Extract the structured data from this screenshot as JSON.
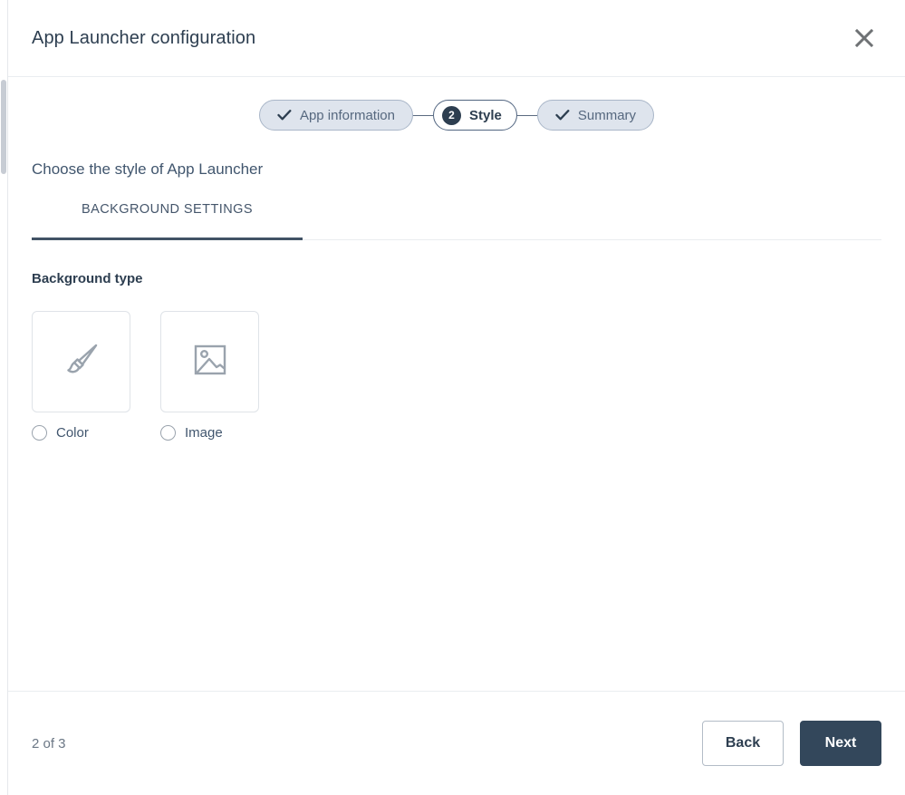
{
  "header": {
    "title": "App Launcher configuration",
    "close_icon": "close-icon"
  },
  "stepper": {
    "steps": [
      {
        "label": "App information",
        "state": "done",
        "badge": "check"
      },
      {
        "label": "Style",
        "state": "active",
        "badge": "2"
      },
      {
        "label": "Summary",
        "state": "done",
        "badge": "check"
      }
    ]
  },
  "content": {
    "heading": "Choose the style of App Launcher",
    "tabs": [
      {
        "label": "BACKGROUND SETTINGS",
        "active": true
      }
    ],
    "background_type": {
      "label": "Background type",
      "options": [
        {
          "label": "Color",
          "icon": "paintbrush-icon",
          "selected": false
        },
        {
          "label": "Image",
          "icon": "image-icon",
          "selected": false
        }
      ]
    }
  },
  "footer": {
    "page_count": "2 of 3",
    "back_label": "Back",
    "next_label": "Next"
  },
  "colors": {
    "primary": "#33475b",
    "step_done_bg": "#dee4ed",
    "step_done_border": "#a9b6c8",
    "text_dark": "#2d3e50",
    "muted": "#6b7785",
    "icon_gray": "#9aa3ad"
  }
}
